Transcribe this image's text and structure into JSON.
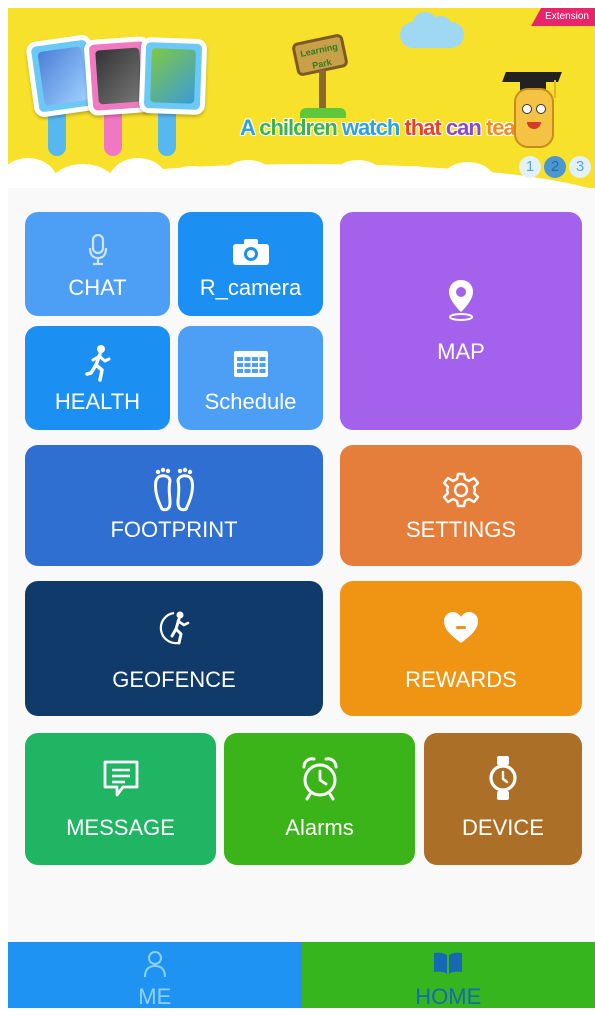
{
  "banner": {
    "badge": "Extension",
    "slogan_words": [
      "A",
      "children",
      "watch",
      "that",
      "can",
      "teach"
    ],
    "sign_text": "Learning Park",
    "pages": [
      "1",
      "2",
      "3"
    ],
    "active_page": "2"
  },
  "tiles": {
    "chat": {
      "label": "CHAT",
      "color": "#4d9ef5",
      "icon": "microphone-icon"
    },
    "r_camera": {
      "label": "R_camera",
      "color": "#1c8ff2",
      "icon": "camera-icon"
    },
    "map": {
      "label": "MAP",
      "color": "#a461ec",
      "icon": "location-pin-icon"
    },
    "health": {
      "label": "HEALTH",
      "color": "#1c8ff2",
      "icon": "running-person-icon"
    },
    "schedule": {
      "label": "Schedule",
      "color": "#4d9ef5",
      "icon": "timetable-icon"
    },
    "footprint": {
      "label": "FOOTPRINT",
      "color": "#2f6fd1",
      "icon": "footprints-icon"
    },
    "settings": {
      "label": "SETTINGS",
      "color": "#e57e3b",
      "icon": "gear-icon"
    },
    "geofence": {
      "label": "GEOFENCE",
      "color": "#0f3a6a",
      "icon": "geofence-runner-icon"
    },
    "rewards": {
      "label": "REWARDS",
      "color": "#ef9413",
      "icon": "heart-icon"
    },
    "message": {
      "label": "MESSAGE",
      "color": "#1fb562",
      "icon": "message-icon"
    },
    "alarms": {
      "label": "Alarms",
      "color": "#3ab419",
      "icon": "alarm-clock-icon"
    },
    "device": {
      "label": "DEVICE",
      "color": "#ac6f27",
      "icon": "watch-icon"
    }
  },
  "tabbar": {
    "me": {
      "label": "ME",
      "icon": "person-icon"
    },
    "home": {
      "label": "HOME",
      "icon": "book-icon",
      "selected": true
    }
  }
}
